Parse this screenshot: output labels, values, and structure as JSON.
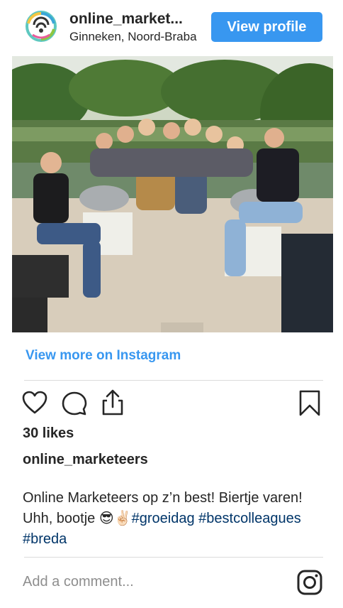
{
  "header": {
    "username": "online_market...",
    "location": "Ginneken, Noord-Braba",
    "view_profile_label": "View profile"
  },
  "post": {
    "image_alt": "Group of friends on a boat on a canal",
    "view_more_label": "View more on Instagram",
    "likes": "30 likes",
    "author": "online_marketeers",
    "caption_text": "Online Marketeers op z’n best! Biertje varen! Uhh, bootje 😎✌🏻",
    "caption_tag_1": "#groeidag",
    "caption_tag_2": "#bestcolleagues",
    "caption_tag_3": "#breda"
  },
  "comment": {
    "placeholder": "Add a comment..."
  },
  "icons": {
    "like": "heart-icon",
    "comment": "comment-icon",
    "share": "share-icon",
    "save": "bookmark-icon",
    "brand": "instagram-icon"
  },
  "colors": {
    "accent": "#3897f0",
    "hashtag": "#003569",
    "muted": "#8e8e8e",
    "divider": "#dbdbdb"
  }
}
